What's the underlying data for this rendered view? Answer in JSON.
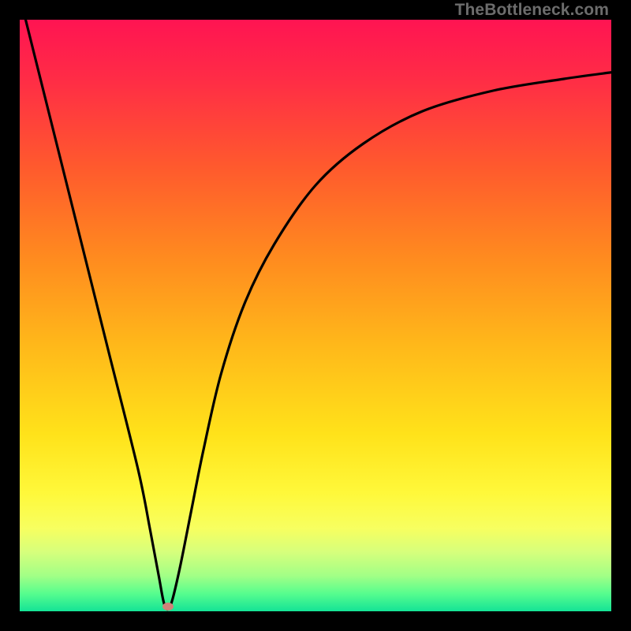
{
  "watermark": "TheBottleneck.com",
  "chart_data": {
    "type": "line",
    "title": "",
    "xlabel": "",
    "ylabel": "",
    "xlim": [
      0,
      100
    ],
    "ylim": [
      0,
      100
    ],
    "gradient_stops": [
      {
        "pos": 0.0,
        "color": "#ff1452"
      },
      {
        "pos": 0.1,
        "color": "#ff2c46"
      },
      {
        "pos": 0.25,
        "color": "#ff5a2d"
      },
      {
        "pos": 0.4,
        "color": "#ff8a1f"
      },
      {
        "pos": 0.55,
        "color": "#ffb81a"
      },
      {
        "pos": 0.7,
        "color": "#ffe21a"
      },
      {
        "pos": 0.8,
        "color": "#fff83a"
      },
      {
        "pos": 0.86,
        "color": "#f7ff60"
      },
      {
        "pos": 0.9,
        "color": "#d6ff7c"
      },
      {
        "pos": 0.94,
        "color": "#a2ff86"
      },
      {
        "pos": 0.97,
        "color": "#57fd8e"
      },
      {
        "pos": 1.0,
        "color": "#14e396"
      }
    ],
    "series": [
      {
        "name": "bottleneck-curve",
        "x": [
          1,
          5,
          10,
          15,
          20,
          22,
          23.5,
          24.5,
          25.5,
          27,
          29,
          31,
          34,
          38,
          43,
          50,
          58,
          68,
          80,
          92,
          100
        ],
        "y": [
          100,
          84,
          64,
          44,
          24,
          14,
          6,
          1,
          1,
          7,
          17,
          27,
          40,
          52,
          62,
          72,
          79,
          84.5,
          88,
          90,
          91.1
        ]
      }
    ],
    "minimum_marker": {
      "x": 25,
      "y": 0.8
    }
  }
}
